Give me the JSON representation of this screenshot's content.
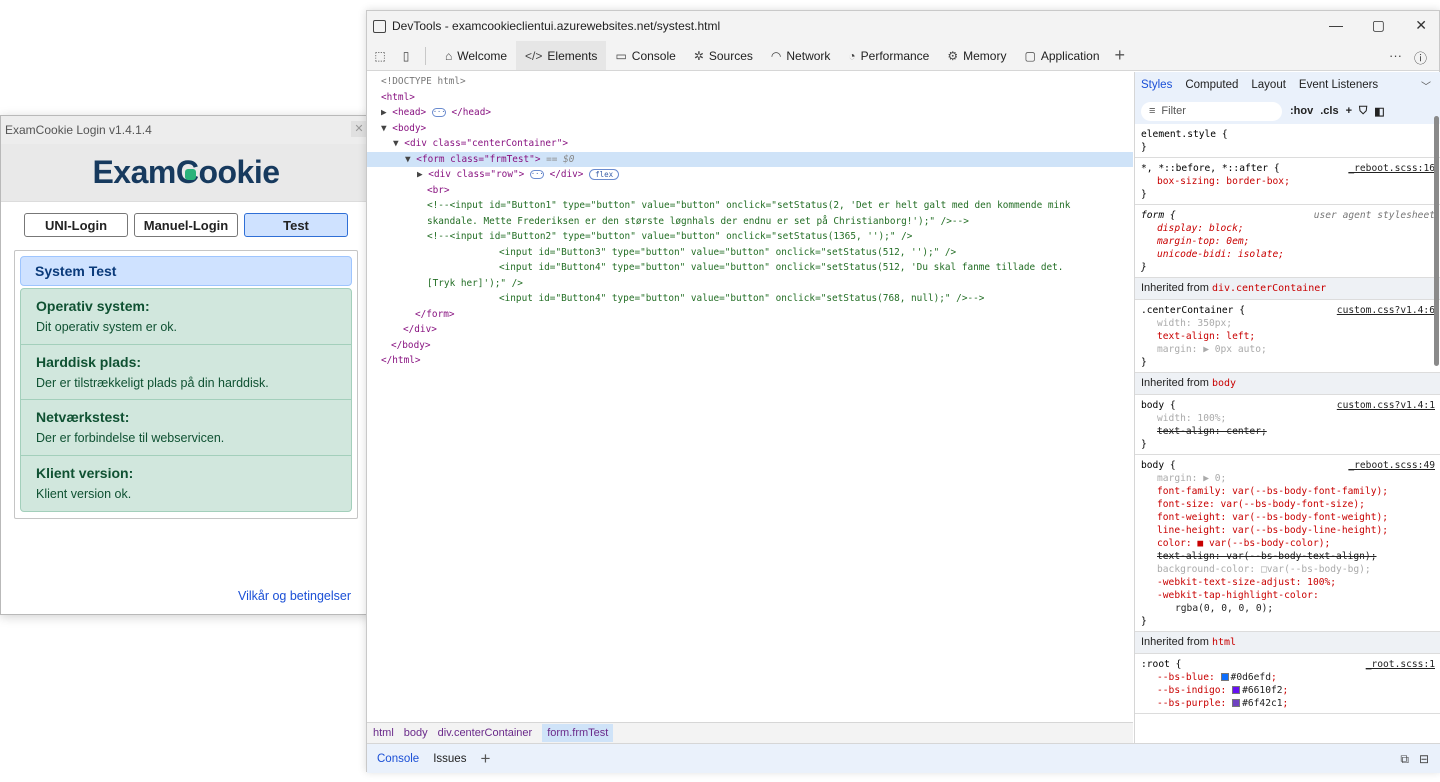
{
  "examcookie": {
    "title": "ExamCookie Login v1.4.1.4",
    "logo_left": "Exam",
    "logo_c": "C",
    "logo_right": "ookie",
    "tabs": [
      "UNI-Login",
      "Manuel-Login",
      "Test"
    ],
    "active_tab": "Test",
    "system_test_label": "System Test",
    "checks": [
      {
        "title": "Operativ system:",
        "desc": "Dit operativ system er ok."
      },
      {
        "title": "Harddisk plads:",
        "desc": "Der er tilstrækkeligt plads på din harddisk."
      },
      {
        "title": "Netværkstest:",
        "desc": "Der er forbindelse til webservicen."
      },
      {
        "title": "Klient version:",
        "desc": "Klient version ok."
      }
    ],
    "terms_link": "Vilkår og betingelser",
    "colors": {
      "brand_navy": "#173a5e",
      "brand_green": "#2ab37b",
      "success_bg": "#d1e7dd",
      "info_bg": "#cfe2ff"
    }
  },
  "devtools": {
    "title": "DevTools - examcookieclientui.azurewebsites.net/systest.html",
    "tabs": [
      {
        "label": "Welcome",
        "icon": "home-icon"
      },
      {
        "label": "Elements",
        "icon": "code-icon"
      },
      {
        "label": "Console",
        "icon": "console-icon"
      },
      {
        "label": "Sources",
        "icon": "bug-icon"
      },
      {
        "label": "Network",
        "icon": "wifi-icon"
      },
      {
        "label": "Performance",
        "icon": "gauge-icon"
      },
      {
        "label": "Memory",
        "icon": "chip-icon"
      },
      {
        "label": "Application",
        "icon": "window-icon"
      }
    ],
    "active_tab": "Elements",
    "breadcrumbs": [
      "html",
      "body",
      "div.centerContainer",
      "form.frmTest"
    ],
    "drawer_tabs": [
      "Console",
      "Issues"
    ],
    "styles_tabs": [
      "Styles",
      "Computed",
      "Layout",
      "Event Listeners"
    ],
    "filter_placeholder": "Filter",
    "filter_tools": [
      ":hov",
      ".cls"
    ],
    "dom": {
      "doctype": "<!DOCTYPE html>",
      "html_open": "<html>",
      "head": "<head>",
      "head_close": "</head>",
      "body_open": "<body>",
      "div_open": "<div class=\"centerContainer\">",
      "form_open": "<form class=\"frmTest\">",
      "form_eq": "== $0",
      "row_div": "<div class=\"row\">",
      "row_close": "</div>",
      "flex_badge": "flex",
      "br": "<br>",
      "c1a": "<!--<input id=\"Button1\" type=\"button\" value=\"button\" onclick=\"setStatus(2, 'Det er helt galt med den kommende mink",
      "c1b": "skandale. Mette Frederiksen er den største løgnhals der endnu er set på Christianborg!');\" />-->",
      "c2": "<!--<input id=\"Button2\" type=\"button\" value=\"button\" onclick=\"setStatus(1365, '');\" />",
      "c3": "<input id=\"Button3\" type=\"button\" value=\"button\" onclick=\"setStatus(512, '');\" />",
      "c4a": "<input id=\"Button4\" type=\"button\" value=\"button\" onclick=\"setStatus(512, 'Du skal fanme tillade det.",
      "c4b": "[Tryk her]');\" />",
      "c5": "<input id=\"Button4\" type=\"button\" value=\"button\" onclick=\"setStatus(768, null);\" />-->",
      "form_close": "</form>",
      "div_close": "</div>",
      "body_close": "</body>",
      "html_close": "</html>"
    },
    "styles": {
      "element_style": "element.style {",
      "close_brace": "}",
      "reboot_sel": "*, *::before, *::after {",
      "reboot_src": "_reboot.scss:16",
      "reboot_prop": "box-sizing: border-box;",
      "form_sel": "form {",
      "ua_label": "user agent stylesheet",
      "form_props": [
        "display: block;",
        "margin-top: 0em;",
        "unicode-bidi: isolate;"
      ],
      "inherited_label": "Inherited from",
      "inh1": "div.centerContainer",
      "cc_sel": ".centerContainer {",
      "cc_src": "custom.css?v1.4:6",
      "cc_props": [
        "width: 350px;",
        "text-align: left;",
        "margin: ▶ 0px auto;"
      ],
      "inh2": "body",
      "body1_sel": "body {",
      "body1_src": "custom.css?v1.4:1",
      "body1_props": [
        "width: 100%;",
        "text-align: center;"
      ],
      "body2_sel": "body {",
      "body2_src": "_reboot.scss:49",
      "body2_props": [
        "margin: ▶ 0;",
        "font-family: var(--bs-body-font-family);",
        "font-size: var(--bs-body-font-size);",
        "font-weight: var(--bs-body-font-weight);",
        "line-height: var(--bs-body-line-height);",
        "color: ■ var(--bs-body-color);",
        "text-align: var(--bs-body-text-align);",
        "background-color: □var(--bs-body-bg);",
        "-webkit-text-size-adjust: 100%;",
        "-webkit-tap-highlight-color:",
        "rgba(0, 0, 0, 0);"
      ],
      "inh3": "html",
      "root_sel": ":root {",
      "root_src": "_root.scss:1",
      "root_props": [
        {
          "text": "--bs-blue: ",
          "value": "#0d6efd",
          "color": "#0d6efd"
        },
        {
          "text": "--bs-indigo: ",
          "value": "#6610f2",
          "color": "#6610f2"
        },
        {
          "text": "--bs-purple: ",
          "value": "#6f42c1",
          "color": "#6f42c1"
        }
      ]
    }
  }
}
